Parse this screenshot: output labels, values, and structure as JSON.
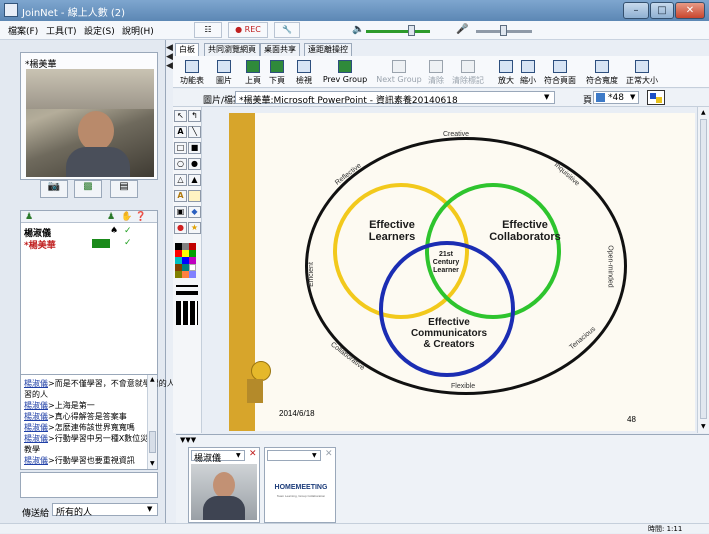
{
  "window": {
    "title": "JoinNet - 線上人數 (2)",
    "buttons": [
      "–",
      "□",
      "✕"
    ]
  },
  "menu": [
    "檔案(F)",
    "工具(T)",
    "設定(S)",
    "說明(H)"
  ],
  "topbar": {
    "rec_label": "● REC"
  },
  "video_panel": {
    "label": "*楊美華"
  },
  "participants": {
    "rows": [
      {
        "name": "楊淑儀",
        "check": "✓"
      },
      {
        "name": "*楊美華",
        "check": "✓"
      }
    ]
  },
  "chat": {
    "lines": [
      {
        "name": "楊淑儀",
        "text": ">而是不僅學習，不會意就學習的人"
      },
      {
        "name": "",
        "text": "習的人"
      },
      {
        "name": "楊淑儀",
        "text": ">上海是第一"
      },
      {
        "name": "楊淑儀",
        "text": ">真心得解答是答案事"
      },
      {
        "name": "楊淑儀",
        "text": ">怎麼連佈該世界寬寬嗎"
      },
      {
        "name": "楊淑儀",
        "text": ">行動學習中另一種X數位災"
      },
      {
        "name": "",
        "text": "教學"
      },
      {
        "name": "楊淑儀",
        "text": ">行動學習也要重視資訊"
      }
    ],
    "send_to_label": "傳送給",
    "send_to_value": "所有的人"
  },
  "tabs": [
    "白板",
    "共同瀏覽網頁",
    "桌面共享",
    "遠距離操控"
  ],
  "toolbar": [
    {
      "label": "功能表",
      "dim": false
    },
    {
      "label": "圖片",
      "dim": false
    },
    {
      "label": "上頁",
      "dim": false
    },
    {
      "label": "下頁",
      "dim": false
    },
    {
      "label": "檢視",
      "dim": false
    },
    {
      "label": "Prev Group",
      "dim": false
    },
    {
      "label": "Next Group",
      "dim": true
    },
    {
      "label": "清除",
      "dim": true
    },
    {
      "label": "清除標記",
      "dim": true
    },
    {
      "label": "放大",
      "dim": false
    },
    {
      "label": "縮小",
      "dim": false
    },
    {
      "label": "符合頁面",
      "dim": false
    },
    {
      "label": "符合寬度",
      "dim": false
    },
    {
      "label": "正常大小",
      "dim": false
    }
  ],
  "document_bar": {
    "label": "圖片/檔案",
    "file": "*楊美華:Microsoft PowerPoint - 資訊素養20140618",
    "page_label": "頁",
    "page_value": "*48"
  },
  "slide": {
    "outer_top": "Creative",
    "outer_right_top": "Inquisitive",
    "outer_right": "Open-minded",
    "outer_right_bottom": "Tenacious",
    "outer_bottom": "Flexible",
    "outer_left_bottom": "Collaborative",
    "outer_left": "Efficient",
    "outer_left_top": "Reflective",
    "circle_learners": "Effective\nLearners",
    "circle_collaborators": "Effective\nCollaborators",
    "circle_creators": "Effective\nCommunicators\n& Creators",
    "center": "21st\nCentury\nLearner",
    "date": "2014/6/18",
    "page_number": "48"
  },
  "video_tiles": [
    {
      "name": "楊淑儀"
    },
    {
      "name": ""
    }
  ],
  "logo": {
    "main": "HOMEMEETING",
    "tagline": "Team Learning, Group Collaboration"
  },
  "status": {
    "time": "時間: 1:11"
  }
}
